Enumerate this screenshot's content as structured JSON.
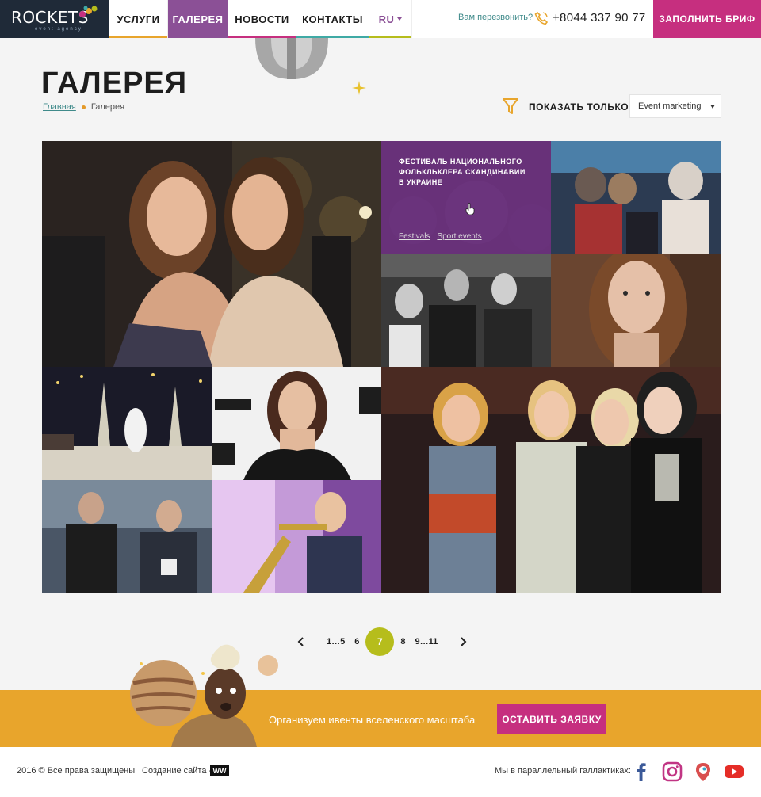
{
  "header": {
    "logo_text": "ROCKETS",
    "logo_sub": "event agency",
    "nav": [
      {
        "label": "УСЛУГИ",
        "color": "#e8a52c"
      },
      {
        "label": "ГАЛЕРЕЯ",
        "color": "#8b5096"
      },
      {
        "label": "НОВОСТИ",
        "color": "#c62f7f"
      },
      {
        "label": "КОНТАКТЫ",
        "color": "#3faaa5"
      },
      {
        "label": "RU",
        "color": "#b6bd1c"
      }
    ],
    "callback_link": "Вам перезвонить?",
    "phone": "+8044 337 90 77",
    "brief_button": "ЗАПОЛНИТЬ БРИФ"
  },
  "page": {
    "title": "ГАЛЕРЕЯ",
    "breadcrumb": {
      "home": "Главная",
      "current": "Галерея"
    },
    "filter_label": "ПОКАЗАТЬ ТОЛЬКО",
    "filter_value": "Event marketing"
  },
  "gallery": {
    "hover_card": {
      "title": "Фестиваль национального фолькльклера Скандинавии в Украине",
      "tags": [
        "Festivals",
        "Sport events"
      ]
    }
  },
  "pagination": {
    "prev": "‹",
    "next": "›",
    "range_start": "1…5",
    "before": "6",
    "current": "7",
    "after": "8",
    "range_end": "9…11"
  },
  "banner": {
    "text": "Организуем ивенты вселенского масштаба",
    "button": "ОСТАВИТЬ ЗАЯВКУ"
  },
  "footer": {
    "copyright": "2016 © Все права защищены",
    "made_by": "Создание сайта -",
    "made_by_logo": "WW",
    "parallel": "Мы в параллельный галлактиках:",
    "social": [
      "facebook-icon",
      "instagram-icon",
      "periscope-icon",
      "youtube-icon"
    ]
  },
  "colors": {
    "accent_purple": "#8b5096",
    "accent_pink": "#c62f7f",
    "accent_orange": "#e8a52c",
    "accent_lime": "#b6bd1c",
    "accent_teal": "#3faaa5"
  }
}
